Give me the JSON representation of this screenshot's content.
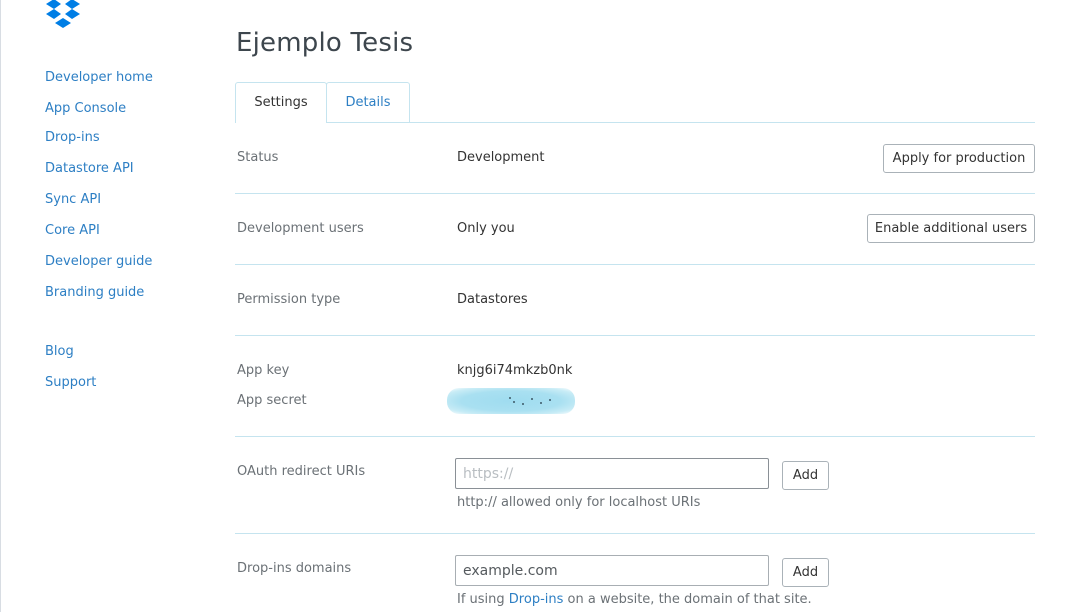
{
  "brand": {
    "logo_icon": "dropbox-logo-icon",
    "color": "#007ee5"
  },
  "sidebar": {
    "items": [
      {
        "label": "Developer home"
      },
      {
        "label": "App Console"
      },
      {
        "label": "Drop-ins"
      },
      {
        "label": "Datastore API"
      },
      {
        "label": "Sync API"
      },
      {
        "label": "Core API"
      },
      {
        "label": "Developer guide"
      },
      {
        "label": "Branding guide"
      },
      {
        "label": "Blog"
      },
      {
        "label": "Support"
      }
    ]
  },
  "page": {
    "title": "Ejemplo Tesis"
  },
  "tabs": [
    {
      "label": "Settings",
      "active": true
    },
    {
      "label": "Details",
      "active": false
    }
  ],
  "settings": {
    "status": {
      "label": "Status",
      "value": "Development",
      "button": "Apply for production"
    },
    "dev_users": {
      "label": "Development users",
      "value": "Only you",
      "button": "Enable additional users"
    },
    "permission": {
      "label": "Permission type",
      "value": "Datastores"
    },
    "app_key": {
      "label": "App key",
      "value": "knjg6i74mkzb0nk"
    },
    "app_secret": {
      "label": "App secret"
    },
    "oauth": {
      "label": "OAuth redirect URIs",
      "placeholder": "https://",
      "button": "Add",
      "help": "http:// allowed only for localhost URIs"
    },
    "dropins": {
      "label": "Drop-ins domains",
      "placeholder": "example.com",
      "button": "Add",
      "help_prefix": "If using ",
      "help_link": "Drop-ins",
      "help_suffix": " on a website, the domain of that site."
    }
  },
  "colors": {
    "link": "#2d7fc4",
    "divider": "#c5e4ef",
    "secret_blur": "#a9e0f1"
  }
}
